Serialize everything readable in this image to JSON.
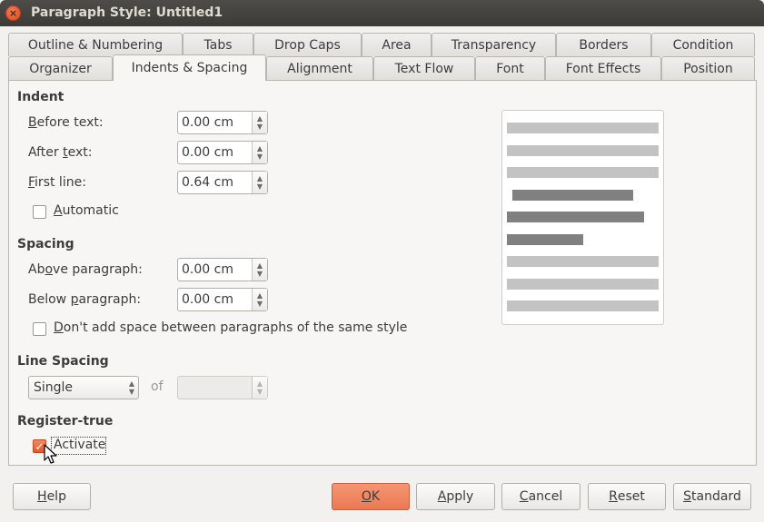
{
  "window": {
    "title": "Paragraph Style: Untitled1",
    "close_glyph": "×"
  },
  "tabs": {
    "row1": [
      "Outline & Numbering",
      "Tabs",
      "Drop Caps",
      "Area",
      "Transparency",
      "Borders",
      "Condition"
    ],
    "row2": [
      "Organizer",
      "Indents & Spacing",
      "Alignment",
      "Text Flow",
      "Font",
      "Font Effects",
      "Position"
    ],
    "active": "Indents & Spacing"
  },
  "indent": {
    "heading": "Indent",
    "before_text": {
      "label_u": "B",
      "label_rest": "efore text:",
      "value": "0.00 cm"
    },
    "after_text": {
      "label_pre": "After ",
      "label_u": "t",
      "label_rest": "ext:",
      "value": "0.00 cm"
    },
    "first_line": {
      "label_u": "F",
      "label_rest": "irst line:",
      "value": "0.64 cm"
    },
    "automatic": {
      "label_u": "A",
      "label_rest": "utomatic",
      "checked": false
    }
  },
  "spacing": {
    "heading": "Spacing",
    "above": {
      "label_pre": "Ab",
      "label_u": "o",
      "label_rest": "ve paragraph:",
      "value": "0.00 cm"
    },
    "below": {
      "label_pre": "Below ",
      "label_u": "p",
      "label_rest": "aragraph:",
      "value": "0.00 cm"
    },
    "no_space": {
      "label_u": "D",
      "label_rest": "on't add space between paragraphs of the same style",
      "checked": false
    }
  },
  "line_spacing": {
    "heading": "Line Spacing",
    "selected": "Single",
    "of_label": "of",
    "of_value": ""
  },
  "register_true": {
    "heading": "Register-true",
    "activate": {
      "label": "Activate",
      "checked": true
    }
  },
  "preview": {
    "bars": [
      "light",
      "light",
      "light",
      "dark",
      "dark",
      "dark",
      "light",
      "light",
      "light"
    ]
  },
  "buttons": {
    "help": {
      "u": "H",
      "rest": "elp"
    },
    "ok": {
      "u": "O",
      "rest": "K"
    },
    "apply": {
      "pre": "",
      "u": "A",
      "rest": "pply"
    },
    "cancel": {
      "u": "C",
      "rest": "ancel"
    },
    "reset": {
      "u": "R",
      "rest": "eset"
    },
    "standard": {
      "u": "S",
      "rest": "tandard"
    }
  },
  "colors": {
    "accent": "#eb7a53",
    "titlebar": "#3c3b37",
    "close": "#e2491e"
  },
  "icons": {
    "close": "close-icon",
    "spin_up": "up-arrow-icon",
    "spin_down": "down-arrow-icon",
    "checkmark": "checkmark-icon",
    "cursor": "mouse-pointer-icon"
  }
}
